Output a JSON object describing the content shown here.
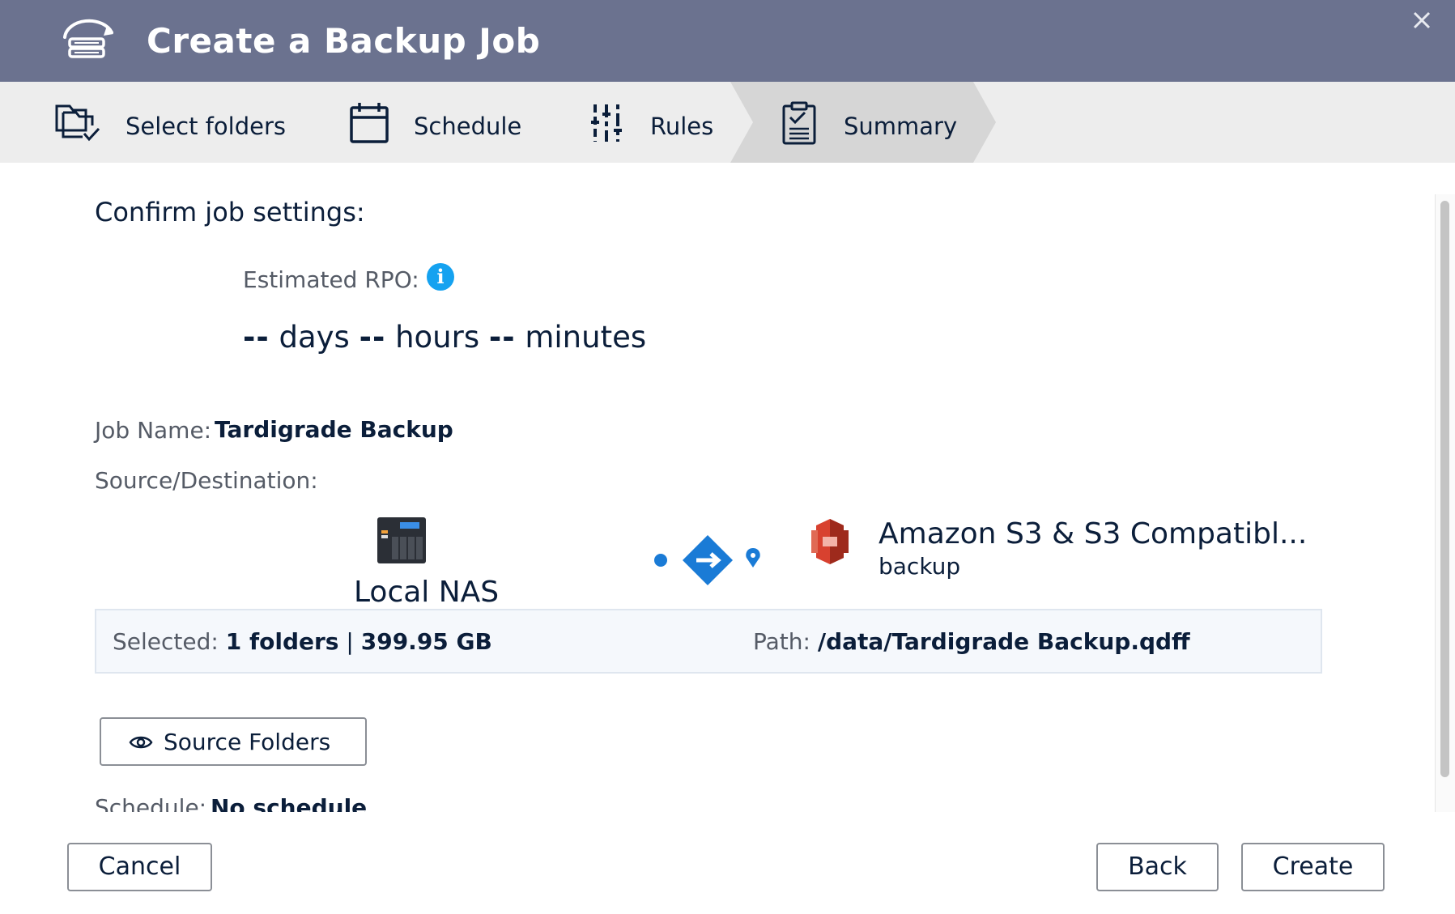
{
  "dialog": {
    "title": "Create a Backup Job",
    "close_icon": "close-icon"
  },
  "steps": [
    {
      "label": "Select folders",
      "icon": "folders-check-icon",
      "active": false
    },
    {
      "label": "Schedule",
      "icon": "calendar-icon",
      "active": false
    },
    {
      "label": "Rules",
      "icon": "sliders-icon",
      "active": false
    },
    {
      "label": "Summary",
      "icon": "clipboard-check-icon",
      "active": true
    }
  ],
  "content": {
    "heading": "Confirm job settings:",
    "rpo": {
      "label": "Estimated RPO:",
      "info_icon": "info-icon",
      "days_value": "--",
      "days_unit": "days",
      "hours_value": "--",
      "hours_unit": "hours",
      "minutes_value": "--",
      "minutes_unit": "minutes"
    },
    "job_name": {
      "label": "Job Name:",
      "value": "Tardigrade Backup"
    },
    "source_destination": {
      "label": "Source/Destination:",
      "source": {
        "name": "Local NAS",
        "icon": "nas-icon"
      },
      "destination": {
        "name": "Amazon S3 & S3 Compatibl...",
        "sub": "backup",
        "icon": "amazon-s3-icon"
      }
    },
    "selected": {
      "label": "Selected:",
      "folders": "1 folders",
      "separator": "|",
      "size": "399.95 GB"
    },
    "path": {
      "label": "Path:",
      "value": "/data/Tardigrade Backup.qdff"
    },
    "source_folders_button": "Source Folders",
    "schedule": {
      "label": "Schedule:",
      "value": "No schedule"
    }
  },
  "footer": {
    "cancel": "Cancel",
    "back": "Back",
    "create": "Create"
  },
  "colors": {
    "header_bg": "#6b728f",
    "steps_bg": "#ededed",
    "active_step_bg": "#d6d6d6",
    "text_dark": "#0b1e3a",
    "info_blue": "#15a2f0",
    "arrow_blue": "#1a7bd6",
    "s3_red": "#d8412f"
  }
}
